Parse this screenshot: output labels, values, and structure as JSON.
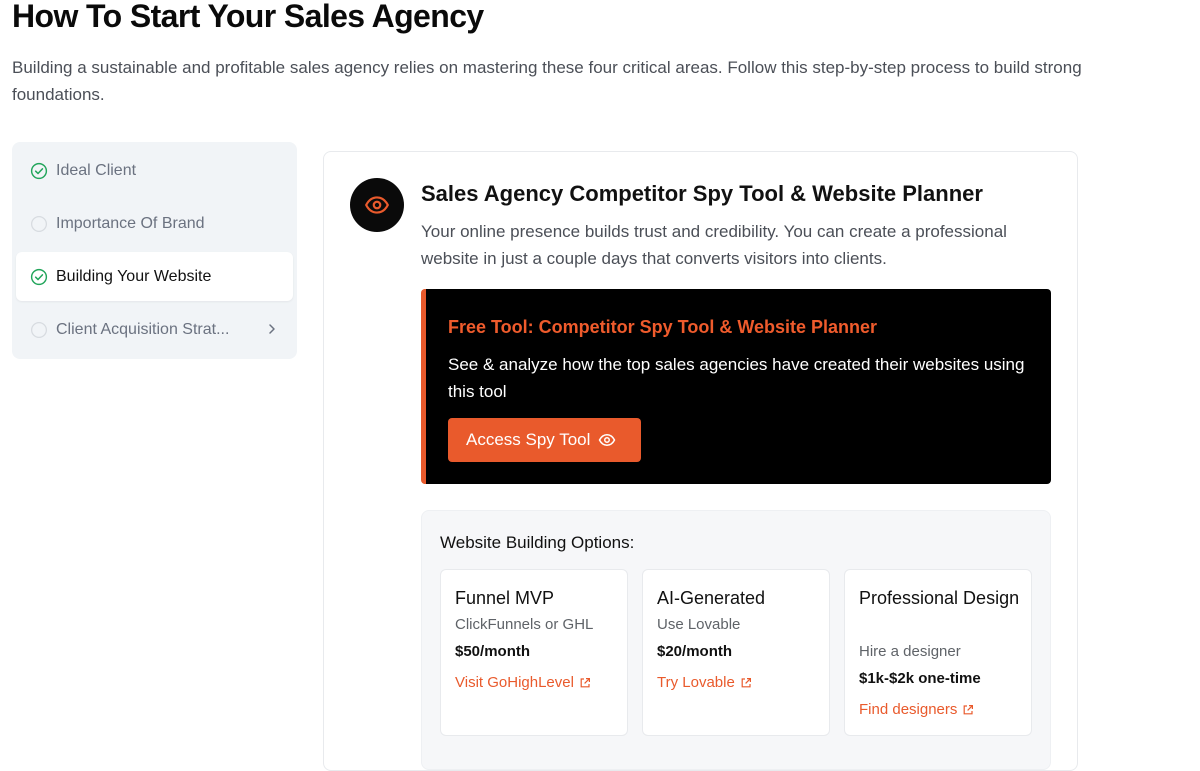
{
  "page": {
    "title": "How To Start Your Sales Agency",
    "intro": "Building a sustainable and profitable sales agency relies on mastering these four critical areas. Follow this step-by-step process to build strong foundations."
  },
  "sidebar": {
    "steps": [
      {
        "label": "Ideal Client",
        "status": "complete",
        "icon": "check-circle-icon"
      },
      {
        "label": "Importance Of Brand",
        "status": "incomplete",
        "icon": "empty-circle-icon"
      },
      {
        "label": "Building Your Website",
        "status": "complete",
        "icon": "check-circle-icon",
        "active": true
      },
      {
        "label": "Client Acquisition Strat...",
        "status": "incomplete",
        "icon": "empty-circle-icon",
        "trailing_icon": "chevron-right-icon"
      }
    ]
  },
  "section": {
    "icon": "eye-icon",
    "title": "Sales Agency Competitor Spy Tool & Website Planner",
    "description": "Your online presence builds trust and credibility. You can create a professional website in just a couple days that converts visitors into clients."
  },
  "promo": {
    "title": "Free Tool: Competitor Spy Tool & Website Planner",
    "description": "See & analyze how the top sales agencies have created their websites using this tool",
    "button_label": "Access Spy Tool",
    "button_icon": "eye-icon"
  },
  "options": {
    "title": "Website Building Options:",
    "items": [
      {
        "name": "Funnel MVP",
        "subtitle": "ClickFunnels or GHL",
        "price": "$50/month",
        "link": "Visit GoHighLevel",
        "link_icon": "external-link-icon"
      },
      {
        "name": "AI-Generated",
        "subtitle": "Use Lovable",
        "price": "$20/month",
        "link": "Try Lovable",
        "link_icon": "external-link-icon"
      },
      {
        "name": "Professional Design",
        "subtitle": "Hire a designer",
        "price": "$1k-$2k one-time",
        "link": "Find designers",
        "link_icon": "external-link-icon"
      }
    ]
  },
  "colors": {
    "accent": "#e95a2c",
    "success": "#22a55b",
    "sidebar_bg": "#f1f4f7",
    "promo_bg": "#000000"
  }
}
